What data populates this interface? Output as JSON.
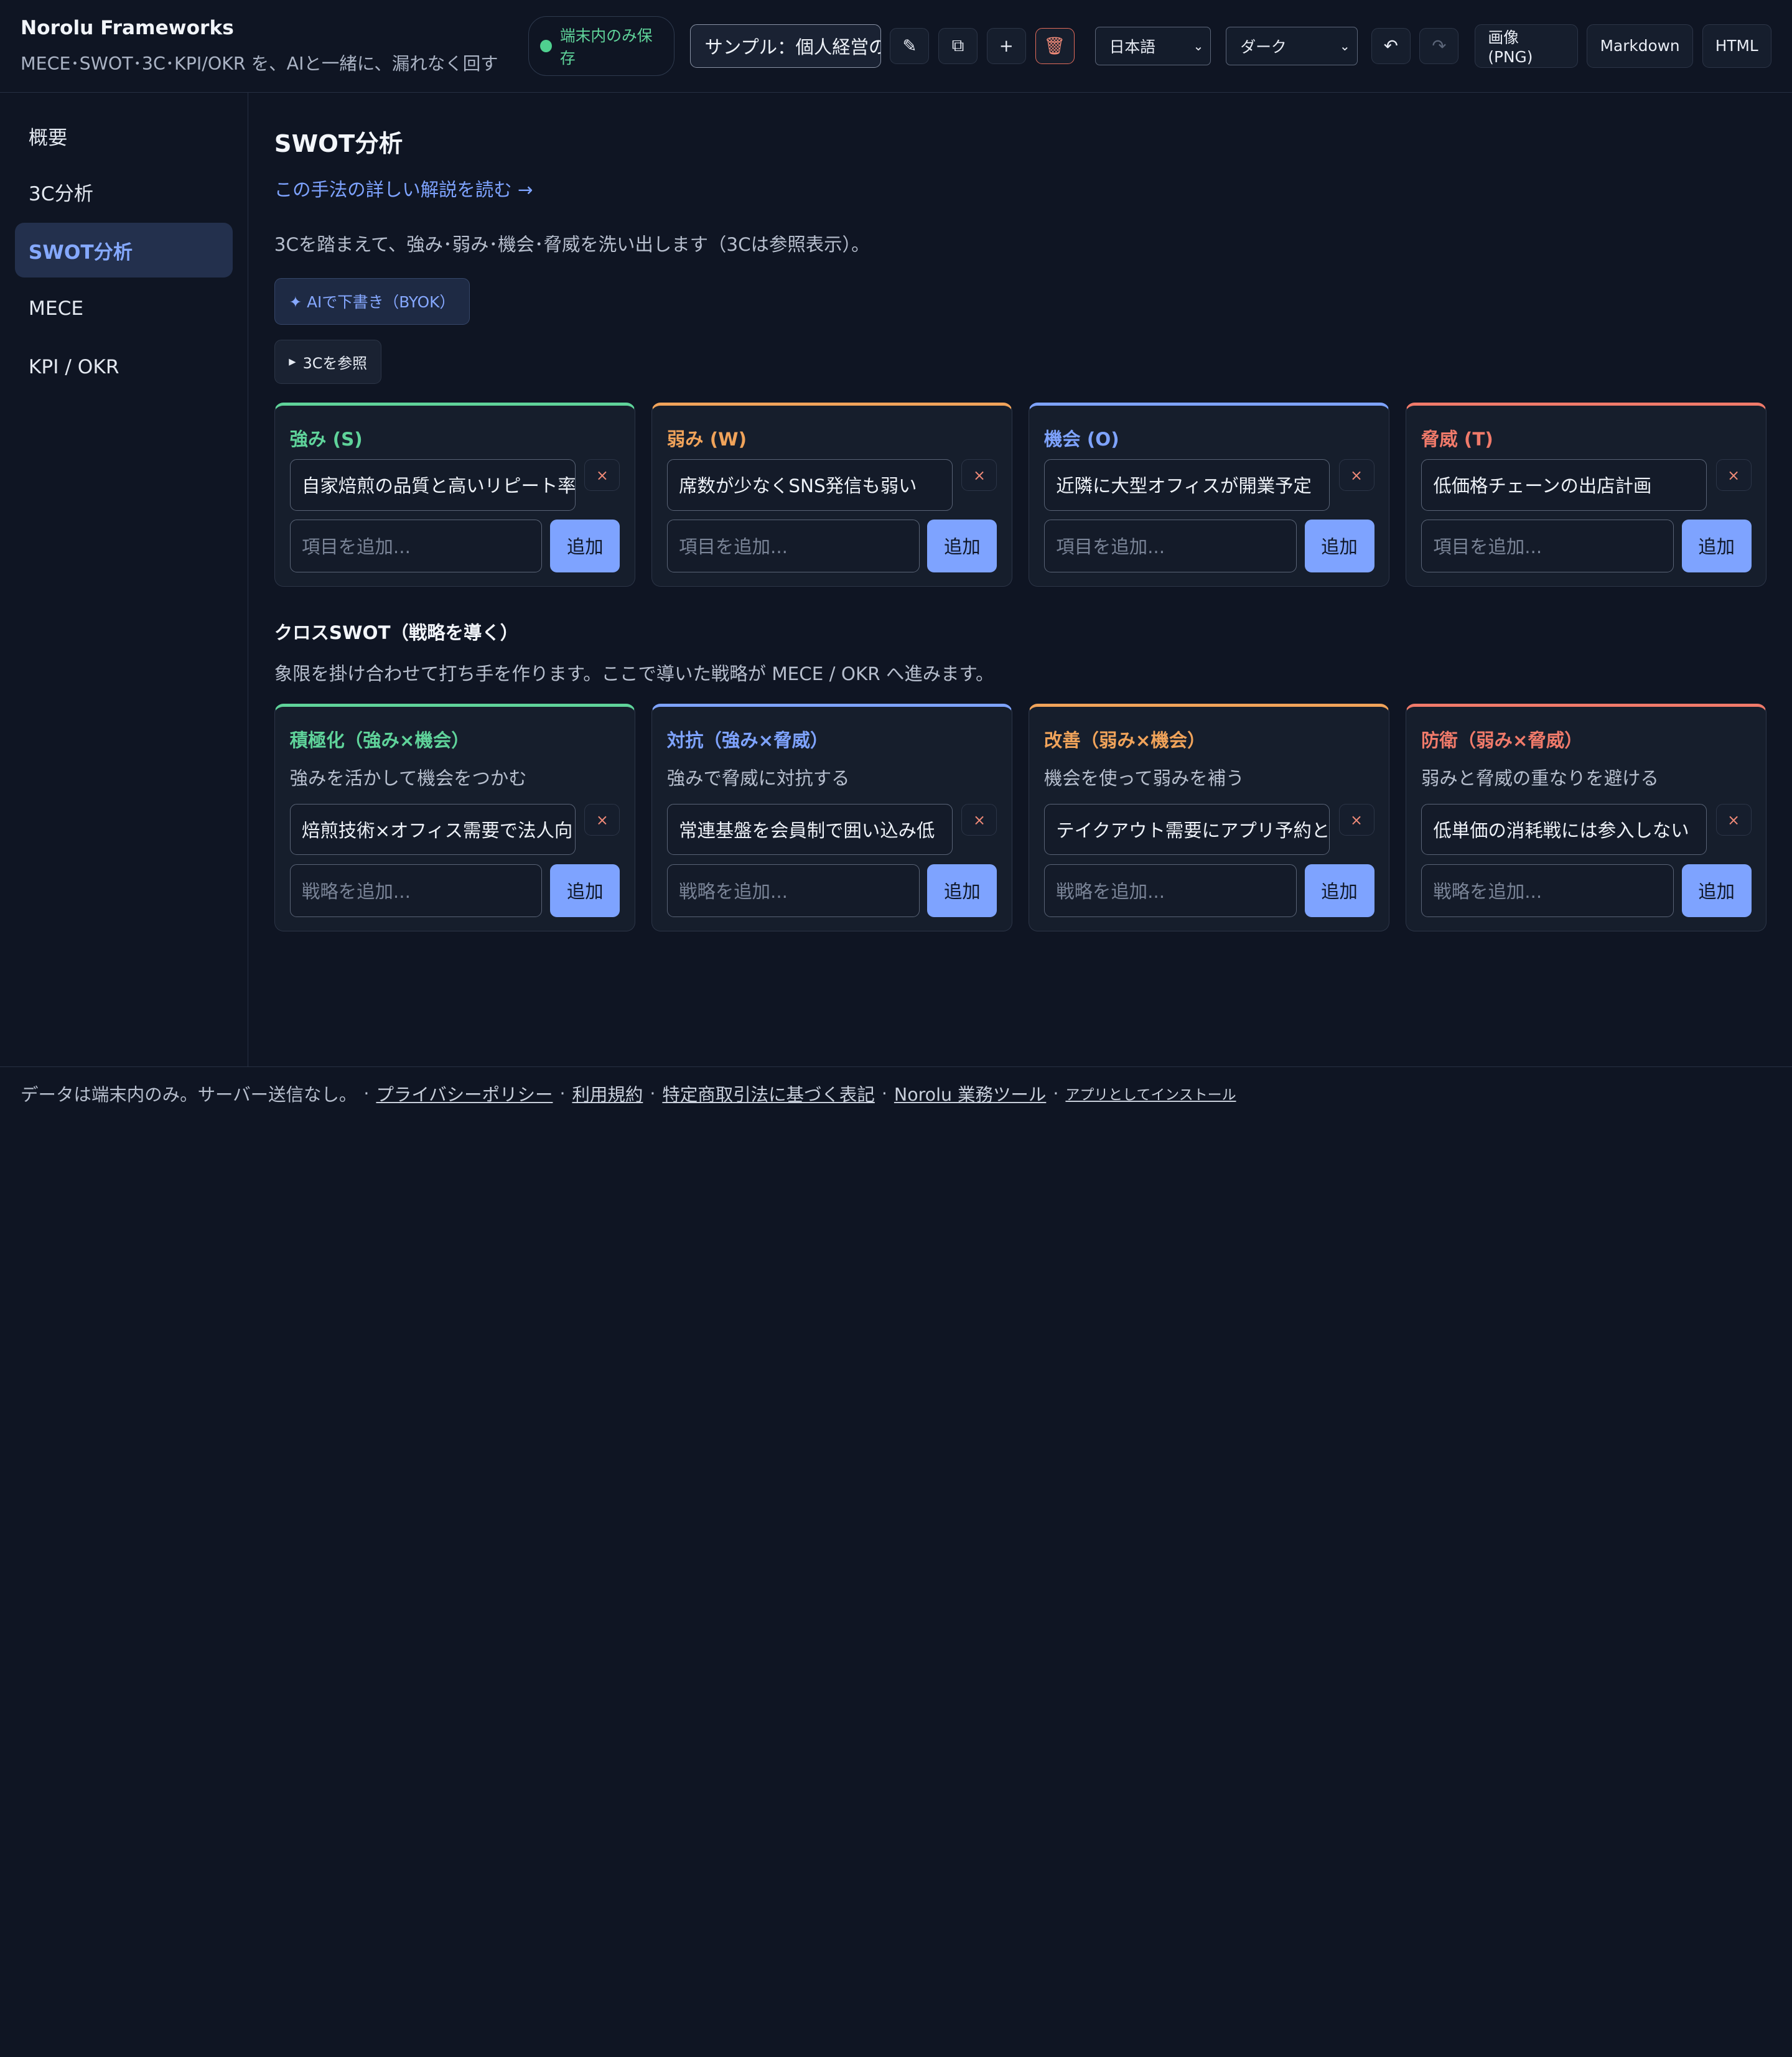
{
  "header": {
    "app_title": "Norolu Frameworks",
    "tagline": "MECE･SWOT･3C･KPI/OKR を、AIと一緒に、漏れなく回す",
    "save_status": "端末内のみ保存",
    "document": "サンプル：個人経営の",
    "language": "日本語",
    "theme": "ダーク",
    "export_png": "画像 (PNG)",
    "export_md": "Markdown",
    "export_html": "HTML",
    "icons": {
      "rename": "✎",
      "duplicate": "⧉",
      "new": "+",
      "delete": "🗑",
      "undo": "↶",
      "redo": "↷",
      "x": "×"
    }
  },
  "sidebar": {
    "items": [
      {
        "label": "概要"
      },
      {
        "label": "3C分析"
      },
      {
        "label": "SWOT分析"
      },
      {
        "label": "MECE"
      },
      {
        "label": "KPI / OKR"
      }
    ]
  },
  "main": {
    "title": "SWOT分析",
    "explain_link": "この手法の詳しい解説を読む →",
    "description": "3Cを踏まえて、強み･弱み･機会･脅威を洗い出します（3Cは参照表示）。",
    "ai_button": "✦ AIで下書き（BYOK）",
    "ref_button": "3Cを参照",
    "add_label": "追加",
    "add_item_placeholder": "項目を追加...",
    "add_strategy_placeholder": "戦略を追加...",
    "quadrants": [
      {
        "title": "強み (S)",
        "item": "自家焙煎の品質と高いリピート率",
        "color": "#5fd39a"
      },
      {
        "title": "弱み (W)",
        "item": "席数が少なくSNS発信も弱い",
        "color": "#f0a35a"
      },
      {
        "title": "機会 (O)",
        "item": "近隣に大型オフィスが開業予定",
        "color": "#7ea3ff"
      },
      {
        "title": "脅威 (T)",
        "item": "低価格チェーンの出店計画",
        "color": "#f07a6a"
      }
    ],
    "cross_title": "クロスSWOT（戦略を導く）",
    "cross_desc": "象限を掛け合わせて打ち手を作ります。ここで導いた戦略が MECE / OKR へ進みます。",
    "cross": [
      {
        "title": "積極化（強み×機会）",
        "sub": "強みを活かして機会をつかむ",
        "item": "焙煎技術×オフィス需要で法人向",
        "color": "#5fd39a"
      },
      {
        "title": "対抗（強み×脅威）",
        "sub": "強みで脅威に対抗する",
        "item": "常連基盤を会員制で囲い込み低",
        "color": "#7ea3ff"
      },
      {
        "title": "改善（弱み×機会）",
        "sub": "機会を使って弱みを補う",
        "item": "テイクアウト需要にアプリ予約とSN",
        "color": "#f0a35a"
      },
      {
        "title": "防衛（弱み×脅威）",
        "sub": "弱みと脅威の重なりを避ける",
        "item": "低単価の消耗戦には参入しない",
        "color": "#f07a6a"
      }
    ]
  },
  "footer": {
    "note": "データは端末内のみ。サーバー送信なし。",
    "sep": "·",
    "privacy": "プライバシーポリシー",
    "terms": "利用規約",
    "tokushoho": "特定商取引法に基づく表記",
    "tools": "Norolu 業務ツール",
    "install": "アプリとしてインストール"
  }
}
